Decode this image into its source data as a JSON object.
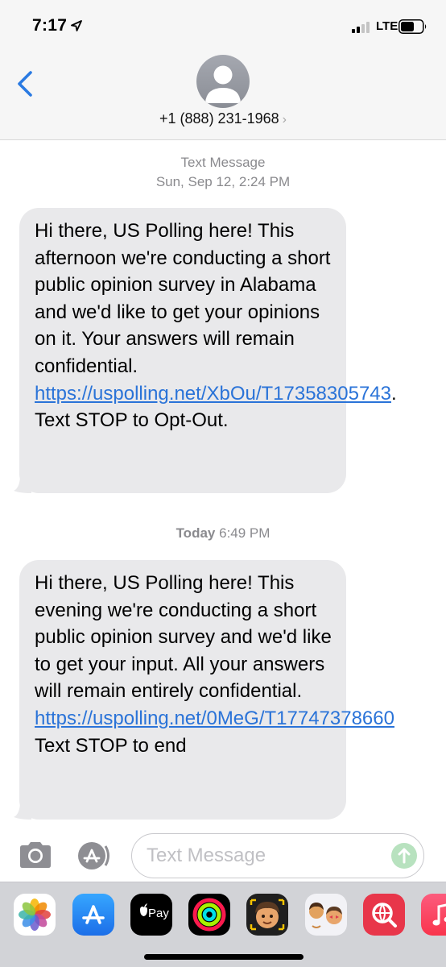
{
  "status_bar": {
    "time": "7:17",
    "network": "LTE",
    "signal_bars": 2,
    "signal_bars_total": 4
  },
  "header": {
    "back_icon": "chevron-left-icon",
    "contact_number": "+1 (888) 231-1968",
    "contact_chevron": "›"
  },
  "conversation": {
    "messages": [
      {
        "stamp_type": "Text Message",
        "stamp_day": "Sun, Sep 12,",
        "stamp_time": "2:24 PM",
        "text_before": "Hi there, US Polling here! This afternoon we're conducting a short public opinion survey in Alabama and we'd like to get your opinions on it. Your answers will remain confidential. ",
        "link": "https://uspolling.net/XbOu/T17358305743",
        "text_after": ". Text STOP to Opt-Out."
      },
      {
        "stamp_day": "Today",
        "stamp_time": "6:49 PM",
        "text_before": "Hi there, US Polling here! This evening we're conducting a short public opinion survey and we'd like to get your input. All your answers will remain entirely confidential. ",
        "link": "https://uspolling.net/0MeG/T17747378660",
        "text_after": " Text STOP to end"
      }
    ]
  },
  "input_bar": {
    "placeholder": "Text Message",
    "camera_icon": "camera-icon",
    "apps_icon": "app-store-icon",
    "send_icon": "send-arrow-icon"
  },
  "app_drawer": {
    "apple_pay_label": "Pay",
    "apps": [
      "photos-icon",
      "app-store-icon",
      "apple-pay-icon",
      "activity-icon",
      "memoji-icon",
      "memoji-stickers-icon",
      "web-search-icon",
      "music-icon"
    ]
  },
  "colors": {
    "link": "#2a73d8",
    "bubble": "#e9e9eb",
    "accent_blue": "#2a7ae2",
    "send_disabled": "#b8e2bf"
  }
}
